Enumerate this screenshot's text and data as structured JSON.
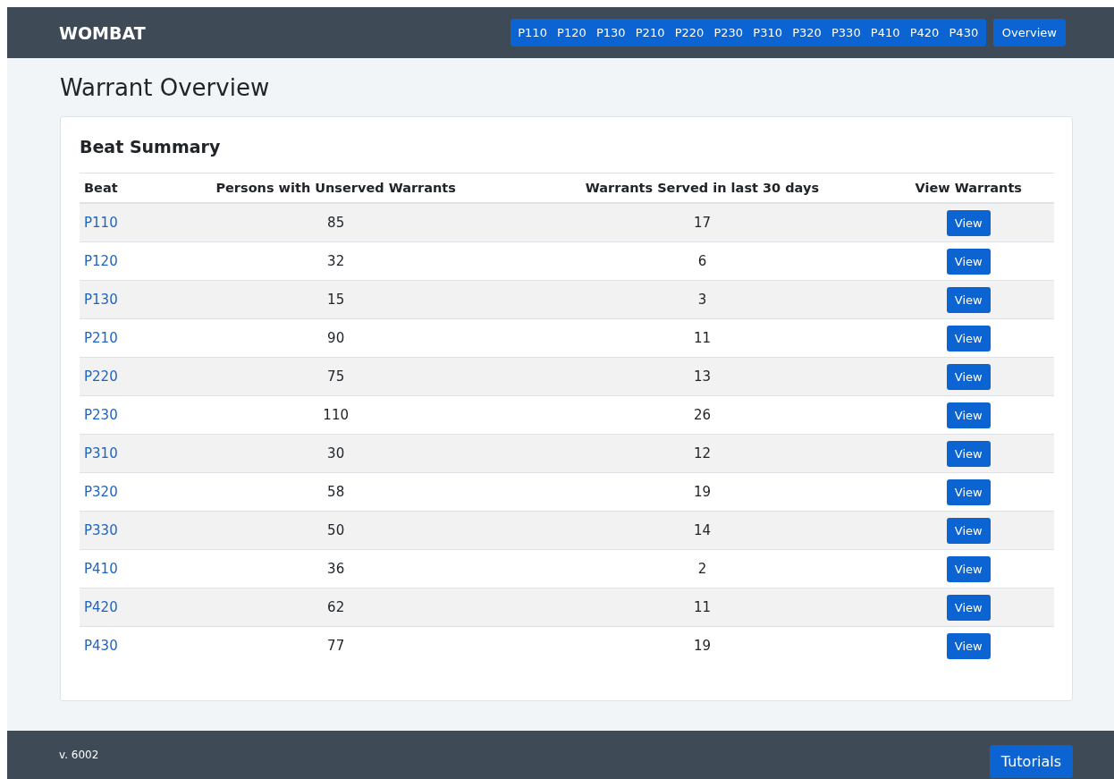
{
  "navbar": {
    "brand": "WOMBAT",
    "beat_links": [
      "P110",
      "P120",
      "P130",
      "P210",
      "P220",
      "P230",
      "P310",
      "P320",
      "P330",
      "P410",
      "P420",
      "P430"
    ],
    "overview_link": "Overview"
  },
  "page_title": "Warrant Overview",
  "card": {
    "title": "Beat Summary",
    "table": {
      "columns": [
        "Beat",
        "Persons with Unserved Warrants",
        "Warrants Served in last 30 days",
        "View Warrants"
      ],
      "rows": [
        {
          "beat": "P110",
          "unserved": "85",
          "served": "17",
          "action": "View"
        },
        {
          "beat": "P120",
          "unserved": "32",
          "served": "6",
          "action": "View"
        },
        {
          "beat": "P130",
          "unserved": "15",
          "served": "3",
          "action": "View"
        },
        {
          "beat": "P210",
          "unserved": "90",
          "served": "11",
          "action": "View"
        },
        {
          "beat": "P220",
          "unserved": "75",
          "served": "13",
          "action": "View"
        },
        {
          "beat": "P230",
          "unserved": "110",
          "served": "26",
          "action": "View"
        },
        {
          "beat": "P310",
          "unserved": "30",
          "served": "12",
          "action": "View"
        },
        {
          "beat": "P320",
          "unserved": "58",
          "served": "19",
          "action": "View"
        },
        {
          "beat": "P330",
          "unserved": "50",
          "served": "14",
          "action": "View"
        },
        {
          "beat": "P410",
          "unserved": "36",
          "served": "2",
          "action": "View"
        },
        {
          "beat": "P420",
          "unserved": "62",
          "served": "11",
          "action": "View"
        },
        {
          "beat": "P430",
          "unserved": "77",
          "served": "19",
          "action": "View"
        }
      ]
    }
  },
  "footer": {
    "version": "v. 6002",
    "tutorials_button": "Tutorials"
  }
}
